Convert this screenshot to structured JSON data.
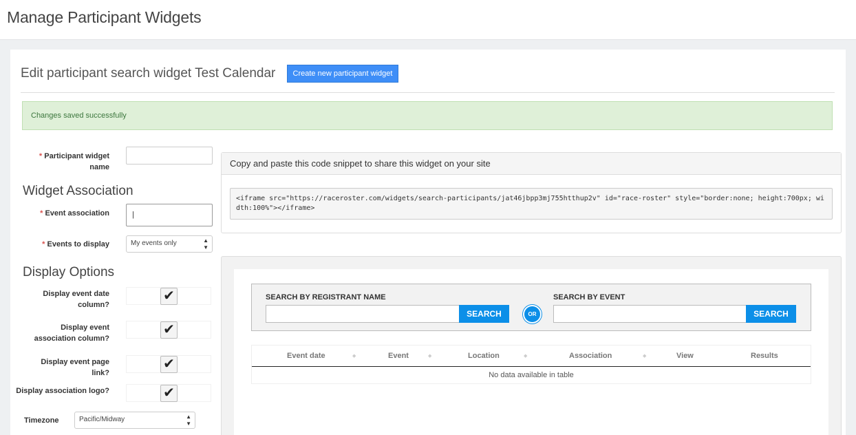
{
  "header": {
    "title": "Manage Participant Widgets"
  },
  "edit": {
    "title": "Edit participant search widget Test Calendar",
    "create_button": "Create new participant widget",
    "alert": "Changes saved successfully"
  },
  "form": {
    "name_label": "Participant widget name",
    "required_mark": "*",
    "name_value": "",
    "widget_association_heading": "Widget Association",
    "event_association_label": "Event association",
    "event_association_value": "|",
    "events_to_display_label": "Events to display",
    "events_to_display_value": "My events only",
    "display_options_heading": "Display Options",
    "options": [
      {
        "label": "Display event date column?",
        "checked": true
      },
      {
        "label": "Display event association column?",
        "checked": true
      },
      {
        "label": "Display event page link?",
        "checked": true
      },
      {
        "label": "Display association logo?",
        "checked": true
      }
    ],
    "check_glyph": "✔",
    "timezone_label": "Timezone",
    "timezone_value": "Pacific/Midway",
    "select_arrows": "▲▼"
  },
  "snippet": {
    "heading": "Copy and paste this code snippet to share this widget on your site",
    "code": "<iframe src=\"https://raceroster.com/widgets/search-participants/jat46jbpp3mj755htthup2v\" id=\"race-roster\" style=\"border:none; height:700px; width:100%\"></iframe>"
  },
  "preview": {
    "search_by_name_label": "SEARCH BY REGISTRANT NAME",
    "search_by_event_label": "SEARCH BY EVENT",
    "search_button": "SEARCH",
    "or_label": "OR",
    "columns": [
      "Event date",
      "Event",
      "Location",
      "Association",
      "View",
      "Results"
    ],
    "sort_glyph": "▲▼",
    "empty_message": "No data available in table"
  },
  "colors": {
    "primary_button": "#3e8ef7",
    "search_button": "#0c8fe8",
    "alert_bg": "#dff0d8",
    "required": "#d9534f"
  }
}
